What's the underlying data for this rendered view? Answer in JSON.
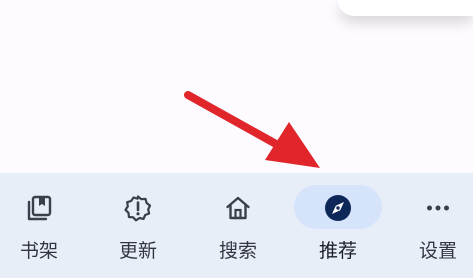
{
  "bottom_nav": {
    "items": [
      {
        "label": "书架",
        "icon": "bookshelf-icon",
        "active": false
      },
      {
        "label": "更新",
        "icon": "badge-alert-icon",
        "active": false
      },
      {
        "label": "搜索",
        "icon": "home-icon",
        "active": false
      },
      {
        "label": "推荐",
        "icon": "compass-icon",
        "active": true
      },
      {
        "label": "设置",
        "icon": "more-dots-icon",
        "active": false
      }
    ]
  },
  "colors": {
    "nav_background": "#e8eef8",
    "active_pill": "#d5e3fb",
    "icon": "#3b3f4a",
    "active_icon": "#0d2758",
    "annotation_arrow": "#e0262a"
  }
}
